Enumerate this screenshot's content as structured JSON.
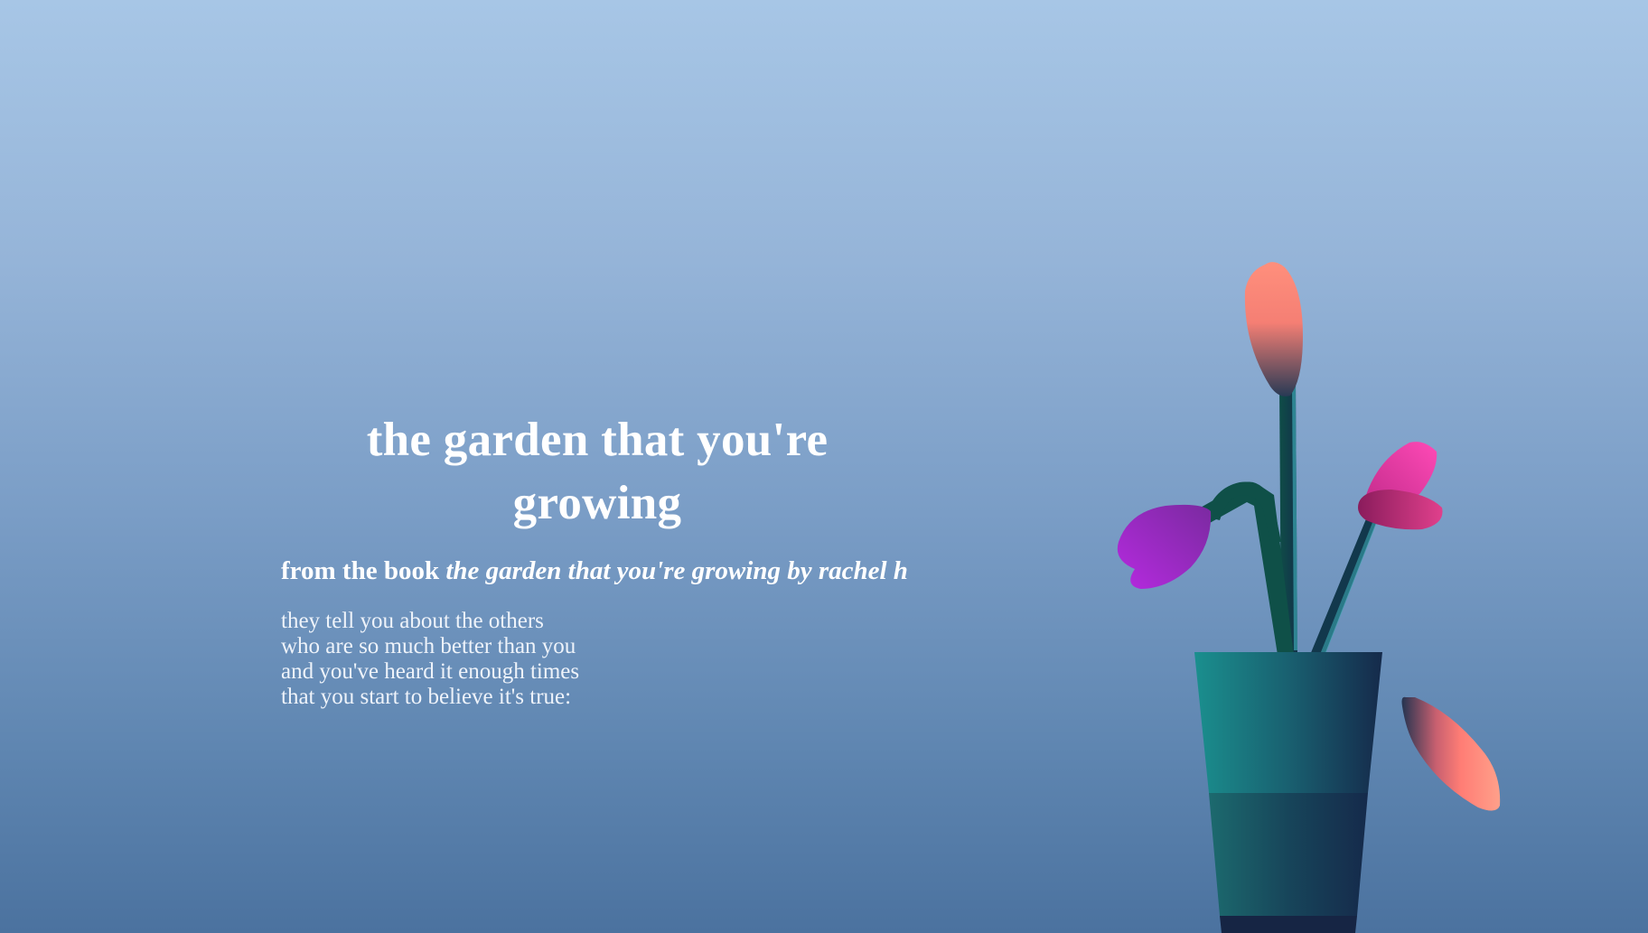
{
  "title": "the garden that you're growing",
  "subtitle": {
    "prefix": "from the book ",
    "book": "the garden that you're growing by rachel h"
  },
  "poem": {
    "lines": [
      "they tell you about the others",
      "who are so much better than you",
      "and you've heard it enough times",
      "that you start to believe it's true:"
    ]
  },
  "illustration": {
    "name": "potted-flowers-illustration",
    "colors": {
      "background_top": "#a7c6e6",
      "background_bottom": "#4b729f",
      "pot_light": "#1a8a8a",
      "pot_dark": "#15284a",
      "stem": "#0f4f4a",
      "petal_coral": "#ff8a78",
      "petal_pink": "#e83aa8",
      "petal_purple": "#a22ad0"
    }
  }
}
